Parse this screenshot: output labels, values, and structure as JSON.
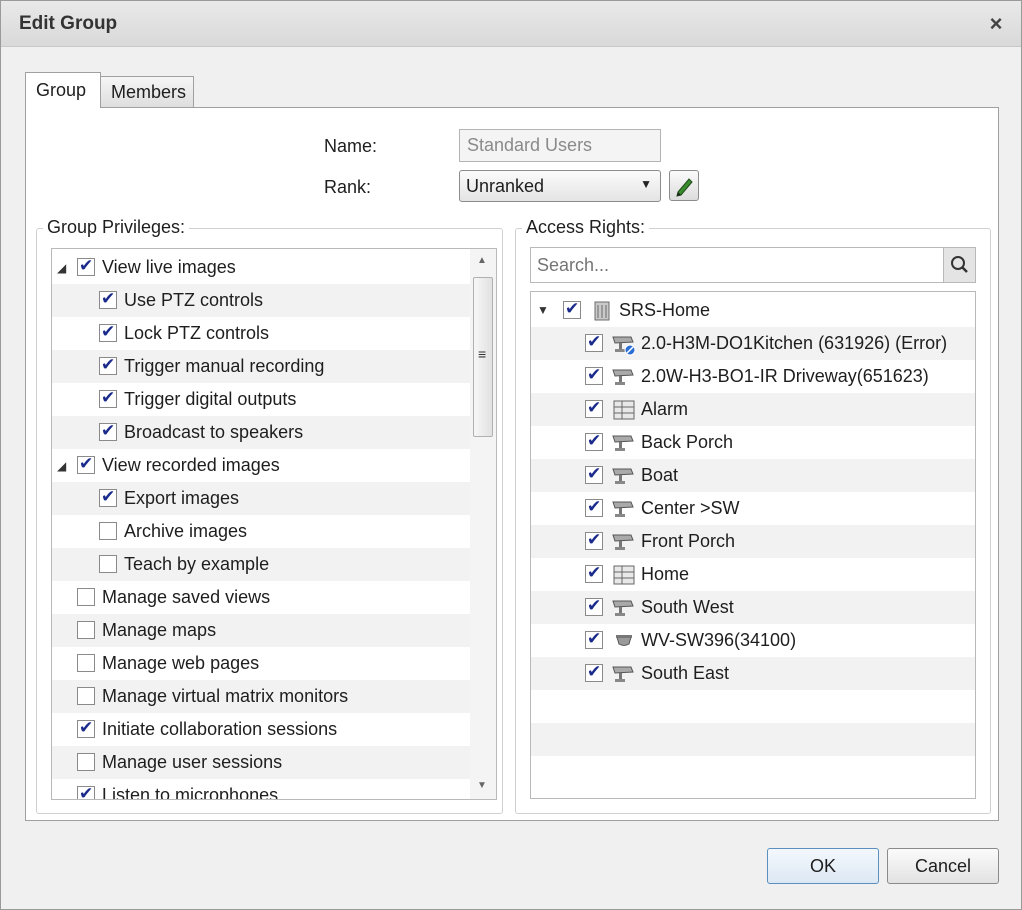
{
  "dialog": {
    "title": "Edit Group"
  },
  "tabs": [
    {
      "label": "Group",
      "active": true
    },
    {
      "label": "Members",
      "active": false
    }
  ],
  "form": {
    "name_label": "Name:",
    "name_value": "Standard Users",
    "rank_label": "Rank:",
    "rank_value": "Unranked"
  },
  "privileges": {
    "legend": "Group Privileges:",
    "items": [
      {
        "label": "View live images",
        "checked": true,
        "level": 0,
        "expander": true
      },
      {
        "label": "Use PTZ controls",
        "checked": true,
        "level": 1
      },
      {
        "label": "Lock PTZ controls",
        "checked": true,
        "level": 1
      },
      {
        "label": "Trigger manual recording",
        "checked": true,
        "level": 1
      },
      {
        "label": "Trigger digital outputs",
        "checked": true,
        "level": 1
      },
      {
        "label": "Broadcast to speakers",
        "checked": true,
        "level": 1
      },
      {
        "label": "View recorded images",
        "checked": true,
        "level": 0,
        "expander": true
      },
      {
        "label": "Export images",
        "checked": true,
        "level": 1
      },
      {
        "label": "Archive images",
        "checked": false,
        "level": 1
      },
      {
        "label": "Teach by example",
        "checked": false,
        "level": 1
      },
      {
        "label": "Manage saved views",
        "checked": false,
        "level": 0
      },
      {
        "label": "Manage maps",
        "checked": false,
        "level": 0
      },
      {
        "label": "Manage web pages",
        "checked": false,
        "level": 0
      },
      {
        "label": "Manage virtual matrix monitors",
        "checked": false,
        "level": 0
      },
      {
        "label": "Initiate collaboration sessions",
        "checked": true,
        "level": 0
      },
      {
        "label": "Manage user sessions",
        "checked": false,
        "level": 0
      },
      {
        "label": "Listen to microphones",
        "checked": true,
        "level": 0
      }
    ]
  },
  "access": {
    "legend": "Access Rights:",
    "search_placeholder": "Search...",
    "root": {
      "label": "SRS-Home",
      "checked": true,
      "icon": "server-icon"
    },
    "items": [
      {
        "label": "2.0-H3M-DO1Kitchen (631926) (Error)",
        "checked": true,
        "icon": "camera-error-icon"
      },
      {
        "label": "2.0W-H3-BO1-IR Driveway(651623)",
        "checked": true,
        "icon": "camera-icon"
      },
      {
        "label": "Alarm",
        "checked": true,
        "icon": "view-grid-icon"
      },
      {
        "label": "Back Porch",
        "checked": true,
        "icon": "camera-icon"
      },
      {
        "label": "Boat",
        "checked": true,
        "icon": "camera-icon"
      },
      {
        "label": "Center >SW",
        "checked": true,
        "icon": "camera-icon"
      },
      {
        "label": "Front Porch",
        "checked": true,
        "icon": "camera-icon"
      },
      {
        "label": "Home",
        "checked": true,
        "icon": "view-grid-icon"
      },
      {
        "label": "South West",
        "checked": true,
        "icon": "camera-icon"
      },
      {
        "label": "WV-SW396(34100)",
        "checked": true,
        "icon": "dome-camera-icon"
      },
      {
        "label": "South East",
        "checked": true,
        "icon": "camera-icon"
      }
    ]
  },
  "buttons": {
    "ok": "OK",
    "cancel": "Cancel"
  },
  "colors": {
    "check": "#1a2b8c",
    "ok_border": "#5b8fc0",
    "row_alt": "#f2f2f2"
  }
}
